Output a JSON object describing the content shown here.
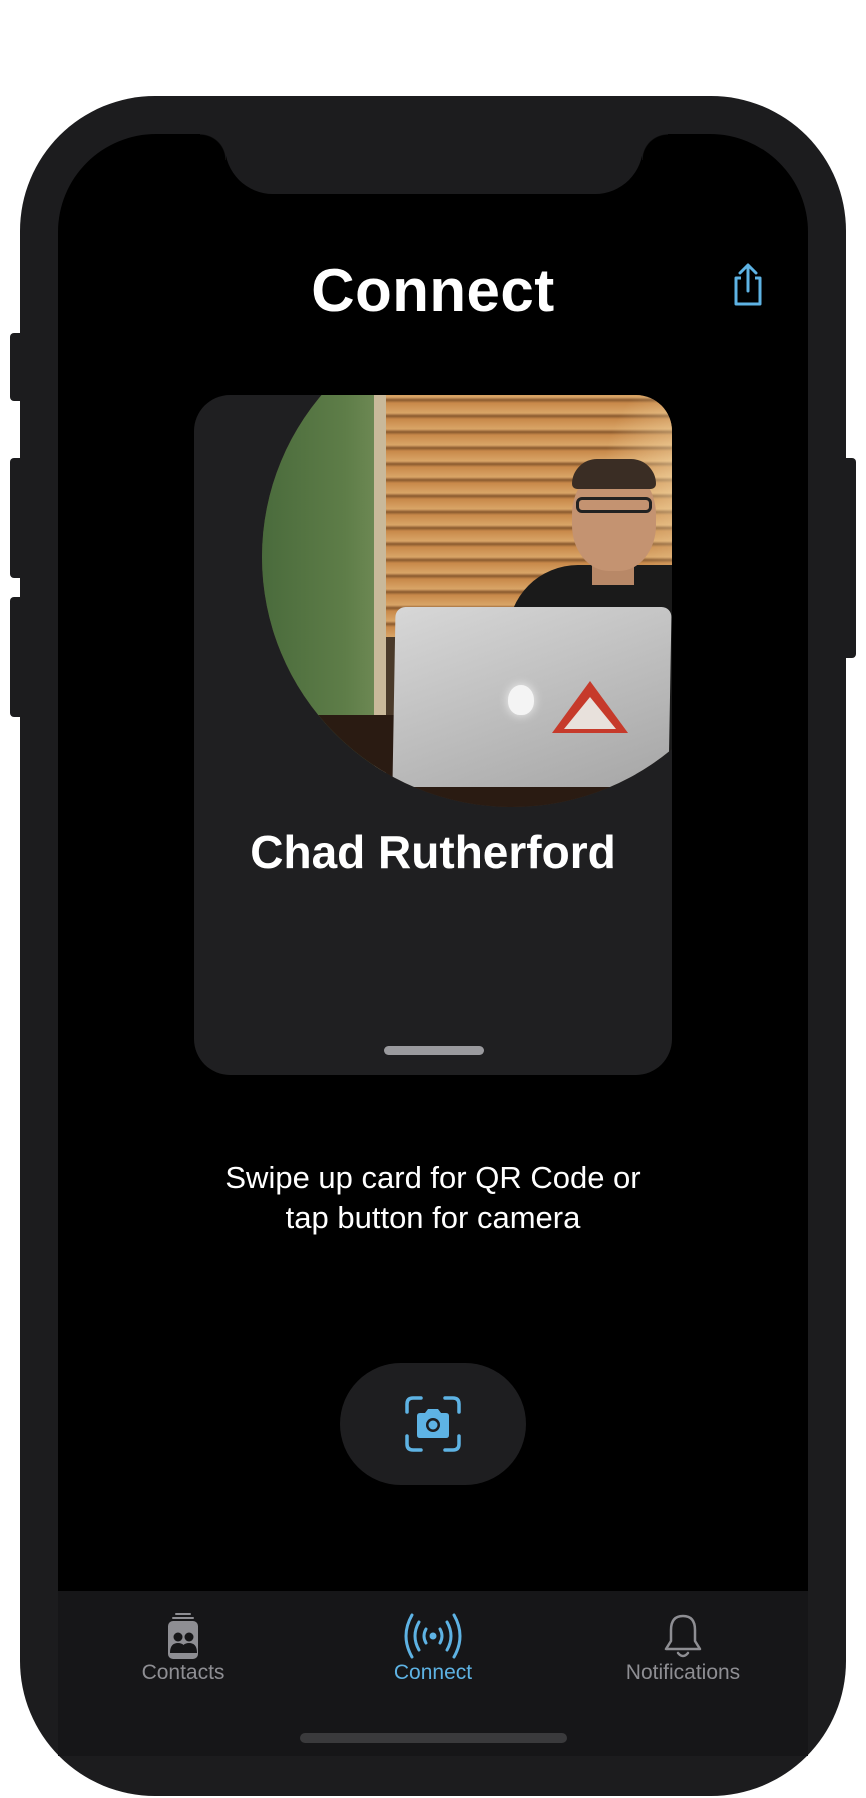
{
  "header": {
    "title": "Connect",
    "share_icon": "share-icon"
  },
  "card": {
    "name": "Chad Rutherford",
    "photo": "profile-photo"
  },
  "hint": {
    "line1": "Swipe up card for QR Code or",
    "line2": "tap button for camera"
  },
  "camera_button": {
    "icon": "camera-viewfinder-icon"
  },
  "tabs": [
    {
      "label": "Contacts",
      "icon": "contacts-icon",
      "active": false
    },
    {
      "label": "Connect",
      "icon": "broadcast-icon",
      "active": true
    },
    {
      "label": "Notifications",
      "icon": "bell-icon",
      "active": false
    }
  ],
  "colors": {
    "accent": "#5eb3e4",
    "inactive": "#8e8e93",
    "background": "#000000",
    "card": "#1f1f21"
  }
}
